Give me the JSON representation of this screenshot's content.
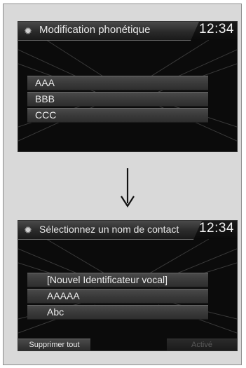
{
  "screen1": {
    "title": "Modification phonétique",
    "clock": "12:34",
    "items": [
      "AAA",
      "BBB",
      "CCC"
    ]
  },
  "screen2": {
    "title": "Sélectionnez un nom de contact",
    "clock": "12:34",
    "items": [
      "[Nouvel Identificateur vocal]",
      "AAAAA",
      "Abc"
    ],
    "buttons": {
      "left": "Supprimer tout",
      "right": "Activé"
    }
  },
  "icons": {
    "settings": "gear-icon",
    "flow": "arrow-down-icon"
  }
}
